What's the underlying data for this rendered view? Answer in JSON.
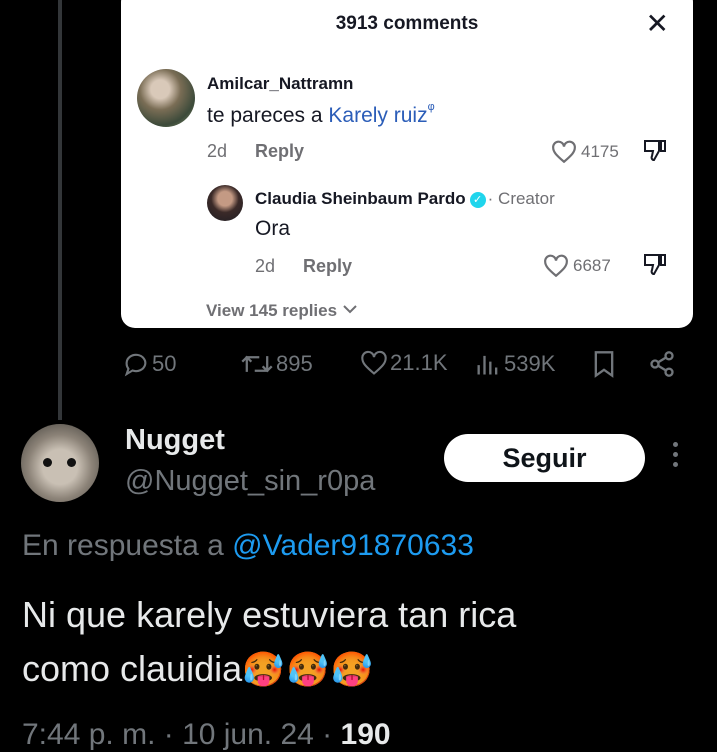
{
  "tiktok_card": {
    "comment_count": "3913 comments",
    "close_symbol": "✕",
    "comment": {
      "username": "Amilcar_Nattramn",
      "text_prefix": "te pareces a ",
      "mention": "Karely ruiz",
      "search_symbol": "ᵠ",
      "age": "2d",
      "reply_label": "Reply",
      "likes": "4175"
    },
    "reply": {
      "username": "Claudia Sheinbaum Pardo",
      "verified_mark": "✓",
      "role": "· Creator",
      "text": "Ora",
      "age": "2d",
      "reply_label": "Reply",
      "likes": "6687"
    },
    "view_replies": "View 145 replies"
  },
  "quoted_actions": {
    "replies": "50",
    "reposts": "895",
    "likes": "21.1K",
    "views": "539K"
  },
  "tweet": {
    "display_name": "Nugget",
    "handle": "@Nugget_sin_r0pa",
    "follow_label": "Seguir",
    "reply_prefix": "En respuesta a ",
    "reply_to": "@Vader91870633",
    "text_line1": "Ni que karely estuviera tan rica",
    "text_line2": "como clauidia",
    "emojis": "🥵🥵🥵",
    "footer_time": "7:44 p. m. · 10 jun. 24 · ",
    "footer_views": "190"
  },
  "colors": {
    "background": "#000000",
    "text_primary": "#e7e9ea",
    "text_secondary": "#71767b",
    "link": "#1d9bf0",
    "card_bg": "#ffffff"
  }
}
